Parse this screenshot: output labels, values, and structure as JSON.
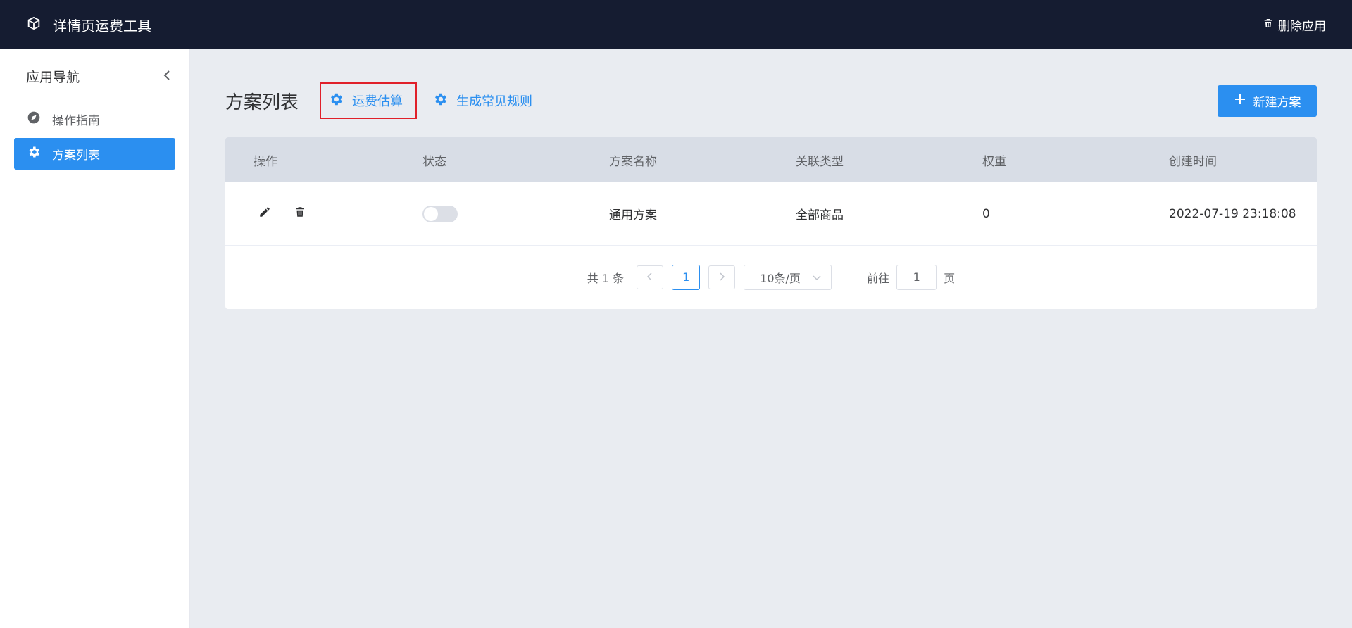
{
  "app": {
    "title": "详情页运费工具",
    "delete_label": "删除应用"
  },
  "sidebar": {
    "title": "应用导航",
    "items": [
      {
        "label": "操作指南",
        "icon": "compass-icon",
        "active": false
      },
      {
        "label": "方案列表",
        "icon": "gear-icon",
        "active": true
      }
    ]
  },
  "main": {
    "page_title": "方案列表",
    "links": [
      {
        "label": "运费估算",
        "icon": "gear-icon",
        "highlighted": true
      },
      {
        "label": "生成常见规则",
        "icon": "gear-icon",
        "highlighted": false
      }
    ],
    "new_button": "新建方案"
  },
  "table": {
    "columns": [
      "操作",
      "状态",
      "方案名称",
      "关联类型",
      "权重",
      "创建时间"
    ],
    "rows": [
      {
        "status": false,
        "name": "通用方案",
        "type": "全部商品",
        "weight": "0",
        "created": "2022-07-19 23:18:08"
      }
    ]
  },
  "pagination": {
    "total": "共 1 条",
    "current": "1",
    "page_size": "10条/页",
    "goto_prefix": "前往",
    "goto_value": "1",
    "goto_suffix": "页"
  },
  "colors": {
    "topbar": "#151c31",
    "primary": "#2b8ff0",
    "highlight_border": "#e0202a",
    "table_header": "#d8dde6",
    "background": "#e9ecf1"
  }
}
